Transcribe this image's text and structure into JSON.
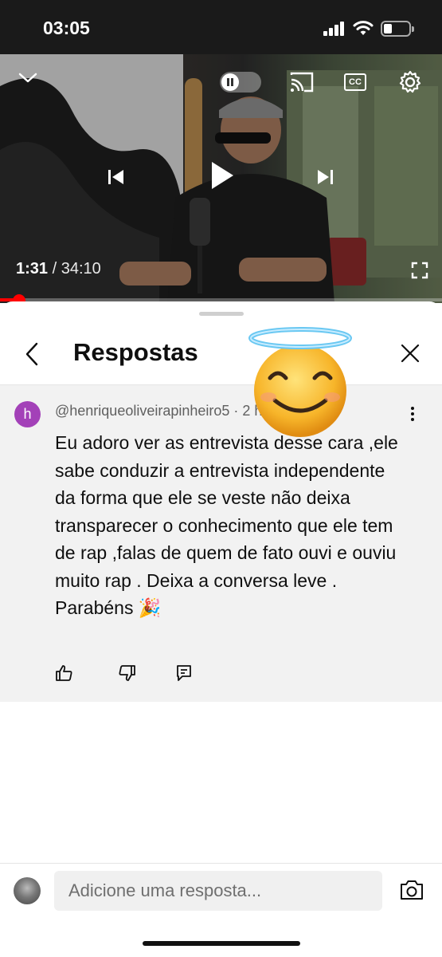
{
  "status_bar": {
    "time": "03:05"
  },
  "video": {
    "time_current": "1:31",
    "time_separator": " / ",
    "time_total": "34:10",
    "cc_label": "CC",
    "progress_fraction": 0.044,
    "progress_color": "#ff0000"
  },
  "sheet": {
    "title": "Respostas"
  },
  "comment": {
    "avatar_letter": "h",
    "avatar_color": "#a341b8",
    "author": "@henriqueoliveirapinheiro5",
    "age": "2 h",
    "text": "Eu adoro ver as entrevista desse cara ,ele sabe conduzir a entrevista independente da forma que ele se veste não deixa transparecer o conhecimento que ele tem de rap ,falas de quem de fato ouvi e ouviu muito rap . Deixa a conversa leve . Parabéns 🎉"
  },
  "reply_box": {
    "placeholder": "Adicione uma resposta..."
  },
  "overlay_emoji": "smiling-face-with-halo",
  "icons": [
    "chevron-down-icon",
    "pause-icon",
    "cast-icon",
    "captions-icon",
    "settings-gear-icon",
    "previous-icon",
    "play-icon",
    "next-icon",
    "fullscreen-icon",
    "back-arrow-icon",
    "close-icon",
    "more-vert-icon",
    "like-icon",
    "dislike-icon",
    "reply-icon",
    "camera-icon"
  ]
}
